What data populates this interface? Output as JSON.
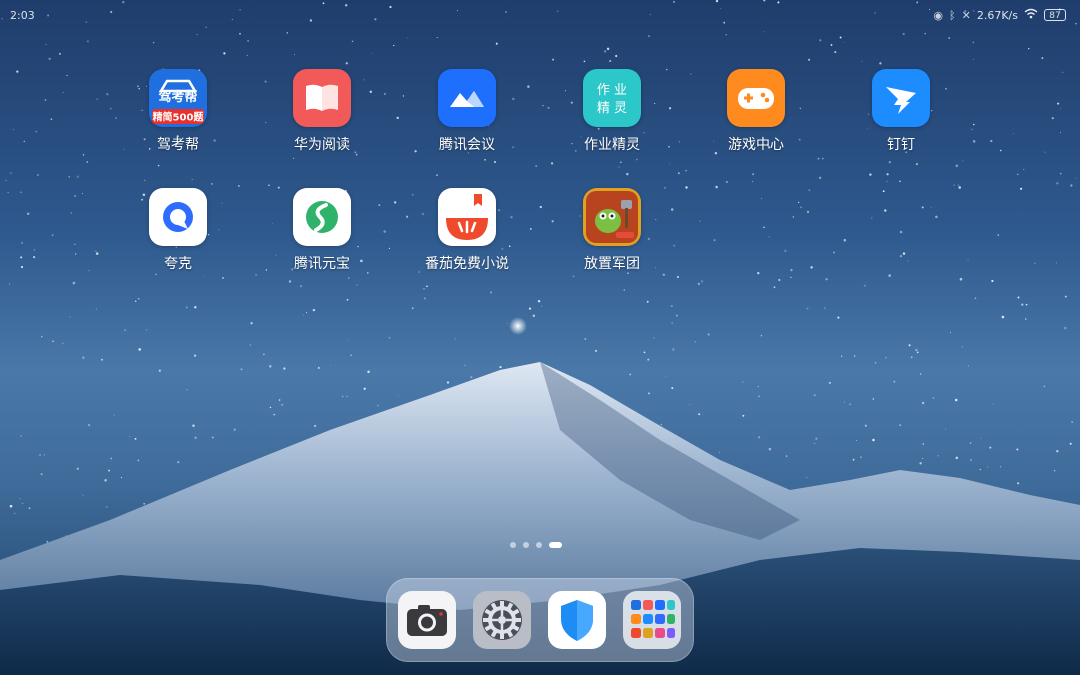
{
  "status_bar": {
    "time": "2:03",
    "network_speed": "2.67K/s",
    "battery": "87"
  },
  "home_apps": [
    {
      "label": "驾考帮",
      "icon": "jiakaobang-icon",
      "badge_text": "精简500题",
      "color": "#1f6fe0"
    },
    {
      "label": "华为阅读",
      "icon": "huawei-reading-icon",
      "color": "#f25a5a"
    },
    {
      "label": "腾讯会议",
      "icon": "tencent-meeting-icon",
      "color": "#1f6fff"
    },
    {
      "label": "作业精灵",
      "icon": "zuoye-jingling-icon",
      "badge_text": "作业精灵",
      "color": "#2cc7c9"
    },
    {
      "label": "游戏中心",
      "icon": "game-center-icon",
      "color": "#ff8a1e"
    },
    {
      "label": "钉钉",
      "icon": "dingtalk-icon",
      "color": "#1c8cff"
    },
    {
      "label": "夸克",
      "icon": "quark-icon",
      "color": "#2f6bff"
    },
    {
      "label": "腾讯元宝",
      "icon": "tencent-yuanbao-icon",
      "color": "#2fb36a"
    },
    {
      "label": "番茄免费小说",
      "icon": "fanqie-novel-icon",
      "color": "#f04a2c"
    },
    {
      "label": "放置军团",
      "icon": "idle-legion-icon",
      "color": "#e0a020"
    }
  ],
  "page_indicator": {
    "count": 4,
    "active": 3
  },
  "dock_apps": [
    {
      "icon": "camera-icon"
    },
    {
      "icon": "settings-gear-icon"
    },
    {
      "icon": "security-shield-icon"
    },
    {
      "icon": "app-folder-icon"
    }
  ]
}
